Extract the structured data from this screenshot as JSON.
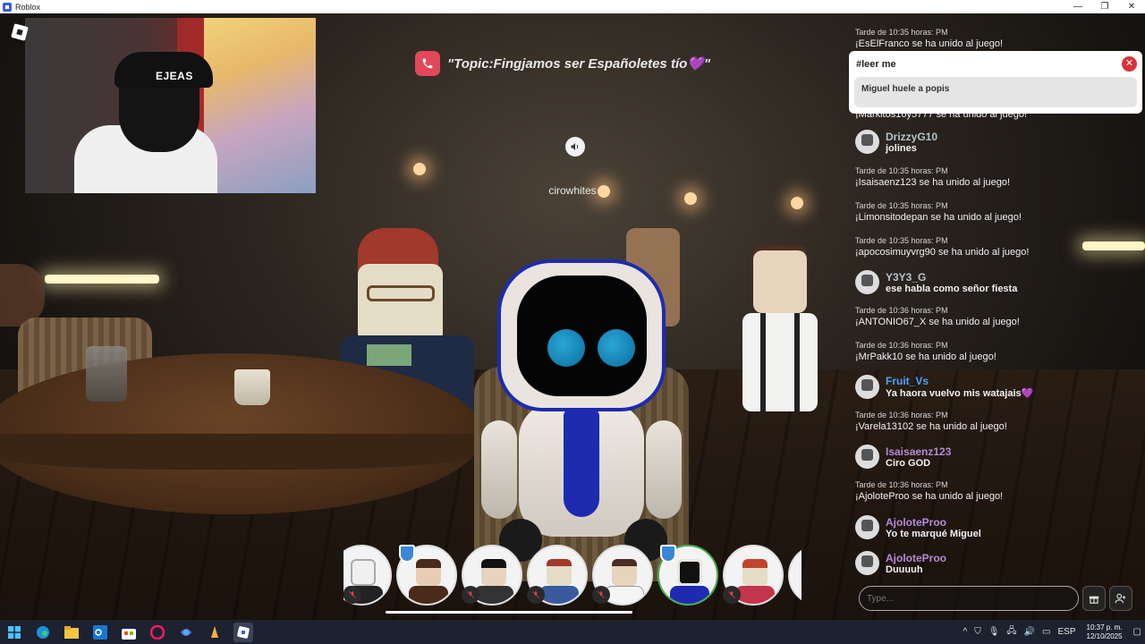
{
  "window": {
    "title": "Roblox",
    "controls": [
      "—",
      "❐",
      "✕"
    ]
  },
  "topic": {
    "text": "\"Topic:Fingjamos ser Españoletes tío💜\""
  },
  "nametag": "cirowhites",
  "pinned": {
    "title": "#leer me",
    "body": "Miguel huele a popis",
    "close": "✕"
  },
  "chat": {
    "top_partial": {
      "stamp": "Tarde de 10:35 horas: PM",
      "text": "¡EsElFranco se ha unido al juego!"
    },
    "partial_under_pinned": "¡Markitos16y5777 se ha unido al juego!",
    "messages": [
      {
        "kind": "user",
        "name": "DrizzyG10",
        "color": "#b6c2c8",
        "text": "jolines"
      },
      {
        "kind": "sys",
        "stamp": "Tarde de 10:35 horas: PM",
        "text": "¡Isaisaenz123 se ha unido al juego!"
      },
      {
        "kind": "sys",
        "stamp": "Tarde de 10:35 horas: PM",
        "text": "¡Limonsitodepan se ha unido al juego!"
      },
      {
        "kind": "sys",
        "stamp": "Tarde de 10:35 horas: PM",
        "text": "¡apocosimuyvrg90 se ha unido al juego!"
      },
      {
        "kind": "user",
        "name": "Y3Y3_G",
        "color": "#b6c2c8",
        "text": "ese habla como señor fiesta"
      },
      {
        "kind": "sys",
        "stamp": "Tarde de 10:36 horas: PM",
        "text": "¡ANTONIO67_X se ha unido al juego!"
      },
      {
        "kind": "sys",
        "stamp": "Tarde de 10:36 horas: PM",
        "text": "¡MrPakk10 se ha unido al juego!"
      },
      {
        "kind": "user",
        "name": "Fruit_Vs",
        "color": "#4aa3ff",
        "text": "Ya haora vuelvo mis watajais💜"
      },
      {
        "kind": "sys",
        "stamp": "Tarde de 10:36 horas: PM",
        "text": "¡Varela13102 se ha unido al juego!"
      },
      {
        "kind": "user",
        "name": "Isaisaenz123",
        "color": "#b48ad9",
        "text": "Ciro GOD"
      },
      {
        "kind": "sys",
        "stamp": "Tarde de 10:36 horas: PM",
        "text": "¡AjoloteProo se ha unido al juego!"
      },
      {
        "kind": "user",
        "name": "AjoloteProo",
        "color": "#b48ad9",
        "text": "Yo te marqué Miguel"
      },
      {
        "kind": "user",
        "name": "AjoloteProo",
        "color": "#b48ad9",
        "text": "Duuuuh"
      }
    ],
    "input_placeholder": "Type..."
  },
  "taskbar": {
    "lang": "ESP",
    "time": "10:37 p. m.",
    "date": "12/10/2025"
  },
  "colors": {
    "topic_phone": "#e2485a",
    "pinned_close": "#d8323c",
    "taskbar_bg": "#1c2230"
  }
}
